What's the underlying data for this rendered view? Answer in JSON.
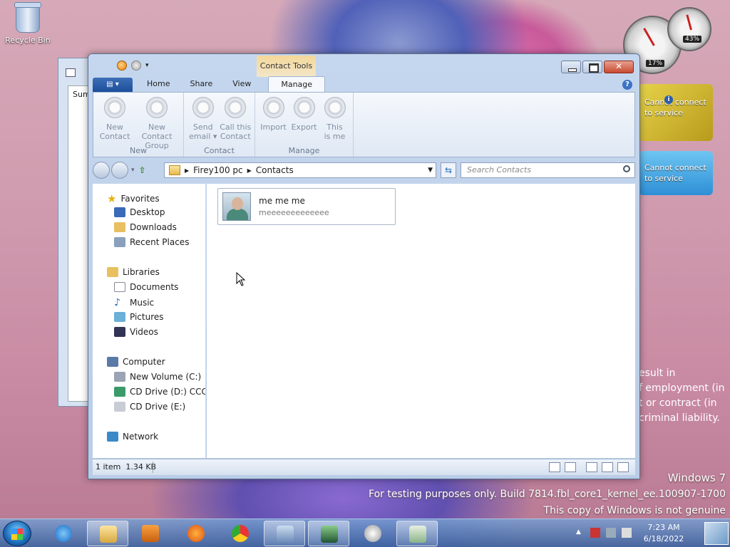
{
  "desktop": {
    "recycle_bin": "Recycle Bin",
    "bg_window_label": "Sum"
  },
  "gadgets": {
    "cpu_pct": "17%",
    "mem_pct": "43%",
    "weather1": [
      "Cannot connect",
      "to service"
    ],
    "weather2": [
      "Cannot connect",
      "to service"
    ]
  },
  "legal_fragments": [
    "esult in",
    "f employment (in",
    "t or contract (in",
    "criminal liability."
  ],
  "watermark": {
    "line1": "Windows 7",
    "line2": "For testing purposes only. Build 7814.fbl_core1_kernel_ee.100907-1700",
    "line3": "This copy of Windows is not genuine"
  },
  "window": {
    "context_tab": "Contact Tools",
    "tabs": [
      "Home",
      "Share",
      "View",
      "Manage"
    ],
    "ribbon": {
      "groups": [
        {
          "label": "New",
          "buttons": [
            [
              "New",
              "Contact"
            ],
            [
              "New Contact",
              "Group"
            ]
          ]
        },
        {
          "label": "Contact",
          "buttons": [
            [
              "Send",
              "email ▾"
            ],
            [
              "Call this",
              "Contact"
            ]
          ]
        },
        {
          "label": "Manage",
          "buttons": [
            [
              "Import",
              ""
            ],
            [
              "Export",
              ""
            ],
            [
              "This",
              "is me"
            ]
          ]
        }
      ]
    },
    "address": {
      "segments": [
        "Firey100 pc",
        "Contacts"
      ]
    },
    "search_placeholder": "Search Contacts",
    "nav": {
      "favorites": "Favorites",
      "favorites_items": [
        "Desktop",
        "Downloads",
        "Recent Places"
      ],
      "libraries": "Libraries",
      "libraries_items": [
        "Documents",
        "Music",
        "Pictures",
        "Videos"
      ],
      "computer": "Computer",
      "computer_items": [
        "New Volume (C:)",
        "CD Drive (D:) CCCOI",
        "CD Drive (E:)"
      ],
      "network": "Network"
    },
    "contact": {
      "name": "me me me",
      "sub": "meeeeeeeeeeeee"
    },
    "status": {
      "items": "1 item",
      "size": "1.34 KB"
    }
  },
  "taskbar": {
    "time": "7:23 AM",
    "date": "6/18/2022"
  }
}
